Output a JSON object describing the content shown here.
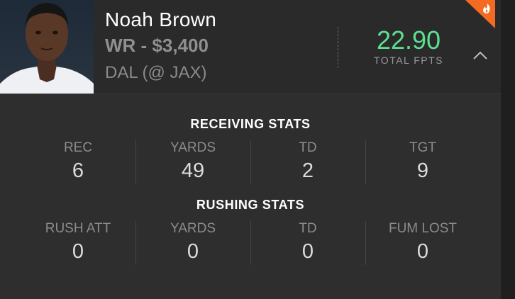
{
  "player": {
    "name": "Noah Brown",
    "position_salary": "WR - $3,400",
    "game": "DAL (@ JAX)"
  },
  "fantasy": {
    "total_fpts": "22.90",
    "total_fpts_label": "TOTAL FPTS"
  },
  "receiving": {
    "title": "RECEIVING STATS",
    "stats": [
      {
        "label": "REC",
        "value": "6"
      },
      {
        "label": "YARDS",
        "value": "49"
      },
      {
        "label": "TD",
        "value": "2"
      },
      {
        "label": "TGT",
        "value": "9"
      }
    ]
  },
  "rushing": {
    "title": "RUSHING STATS",
    "stats": [
      {
        "label": "RUSH ATT",
        "value": "0"
      },
      {
        "label": "YARDS",
        "value": "0"
      },
      {
        "label": "TD",
        "value": "0"
      },
      {
        "label": "FUM LOST",
        "value": "0"
      }
    ]
  },
  "icons": {
    "collapse": "chevron-up-icon",
    "badge": "flame-icon",
    "photo": "player-headshot"
  },
  "colors": {
    "background": "#2e2e2e",
    "header_background": "#2a2a2a",
    "fpts_green": "#5ce08f",
    "badge_orange": "#f26b21"
  }
}
